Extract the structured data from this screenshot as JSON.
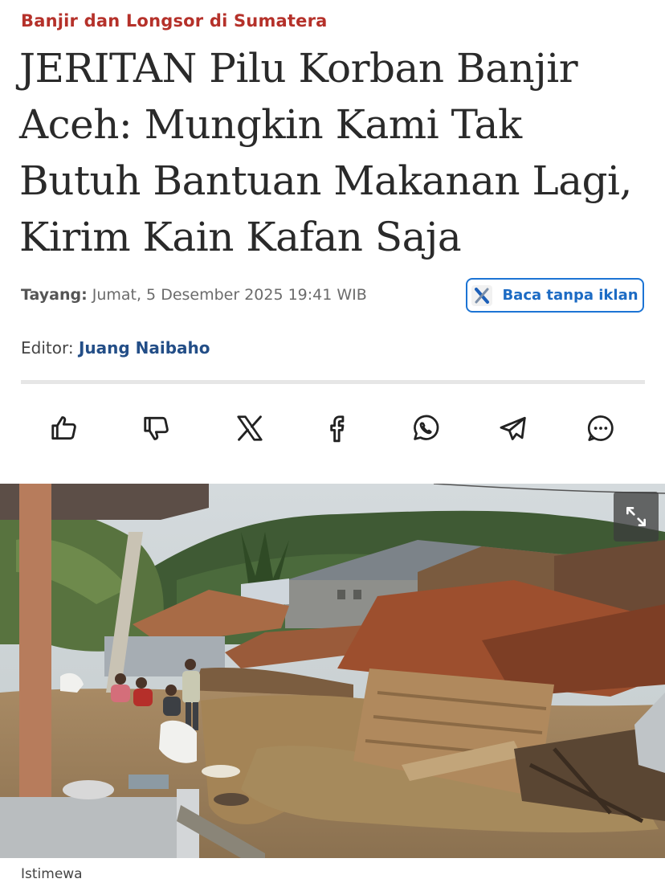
{
  "article": {
    "category": "Banjir dan Longsor di Sumatera",
    "title": "JERITAN Pilu Korban Banjir Aceh: Mungkin Kami Tak Butuh Bantuan Makanan Lagi, Kirim Kain Kafan Saja",
    "published_label": "Tayang:",
    "published_value": "Jumat, 5 Desember 2025 19:41 WIB",
    "editor_label": "Editor:",
    "editor_name": "Juang Naibaho",
    "ad_free_button": "Baca tanpa iklan"
  },
  "share": {
    "icons": [
      "like-icon",
      "dislike-icon",
      "x-icon",
      "facebook-icon",
      "whatsapp-icon",
      "telegram-icon",
      "comment-icon"
    ]
  },
  "photo": {
    "caption": "Istimewa",
    "expand_icon": "expand-icon"
  },
  "colors": {
    "category": "#b5312a",
    "editor_name": "#234e87",
    "button_border": "#1c74d4"
  }
}
